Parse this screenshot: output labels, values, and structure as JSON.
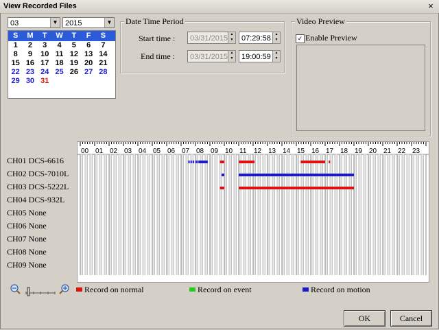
{
  "window": {
    "title": "View Recorded Files",
    "close_icon": "×"
  },
  "calendar": {
    "month": "03",
    "year": "2015",
    "weekdays": [
      "S",
      "M",
      "T",
      "W",
      "T",
      "F",
      "S"
    ],
    "weeks": [
      [
        "1",
        "2",
        "3",
        "4",
        "5",
        "6",
        "7"
      ],
      [
        "8",
        "9",
        "10",
        "11",
        "12",
        "13",
        "14"
      ],
      [
        "15",
        "16",
        "17",
        "18",
        "19",
        "20",
        "21"
      ],
      [
        "22",
        "23",
        "24",
        "25",
        "26",
        "27",
        "28"
      ],
      [
        "29",
        "30",
        "31",
        "",
        "",
        "",
        ""
      ]
    ]
  },
  "date_time_period": {
    "title": "Date Time Period",
    "start_label": "Start time :",
    "start_date": "03/31/2015",
    "start_time": "07:29:58",
    "end_label": "End time :",
    "end_date": "03/31/2015",
    "end_time": "19:00:59"
  },
  "video_preview": {
    "title": "Video Preview",
    "enable_label": "Enable Preview",
    "enabled": true,
    "check_mark": "✓"
  },
  "timeline": {
    "hours": [
      "00",
      "01",
      "02",
      "03",
      "04",
      "05",
      "06",
      "07",
      "08",
      "09",
      "10",
      "11",
      "12",
      "13",
      "14",
      "15",
      "16",
      "17",
      "18",
      "19",
      "20",
      "21",
      "22",
      "23"
    ],
    "channels": [
      {
        "label": "CH01 DCS-6616",
        "segments": [
          {
            "start": 7.5,
            "end": 7.6,
            "type": "motion"
          },
          {
            "start": 7.65,
            "end": 7.75,
            "type": "motion"
          },
          {
            "start": 7.8,
            "end": 7.9,
            "type": "motion"
          },
          {
            "start": 7.95,
            "end": 8.0,
            "type": "motion"
          },
          {
            "start": 8.05,
            "end": 8.15,
            "type": "motion"
          },
          {
            "start": 8.2,
            "end": 8.85,
            "type": "motion"
          },
          {
            "start": 9.7,
            "end": 10.0,
            "type": "normal"
          },
          {
            "start": 11.0,
            "end": 12.1,
            "type": "normal"
          },
          {
            "start": 15.3,
            "end": 17.0,
            "type": "normal"
          },
          {
            "start": 17.25,
            "end": 17.35,
            "type": "normal"
          }
        ]
      },
      {
        "label": "CH02 DCS-7010L",
        "segments": [
          {
            "start": 9.8,
            "end": 10.0,
            "type": "motion"
          },
          {
            "start": 11.0,
            "end": 19.0,
            "type": "motion"
          }
        ]
      },
      {
        "label": "CH03 DCS-5222L",
        "segments": [
          {
            "start": 9.7,
            "end": 10.0,
            "type": "normal"
          },
          {
            "start": 11.0,
            "end": 19.0,
            "type": "normal"
          }
        ]
      },
      {
        "label": "CH04 DCS-932L",
        "segments": []
      },
      {
        "label": "CH05 None",
        "segments": []
      },
      {
        "label": "CH06 None",
        "segments": []
      },
      {
        "label": "CH07 None",
        "segments": []
      },
      {
        "label": "CH08 None",
        "segments": []
      },
      {
        "label": "CH09 None",
        "segments": []
      }
    ]
  },
  "legend": {
    "normal": "Record on normal",
    "event": "Record on event",
    "motion": "Record on motion",
    "colors": {
      "normal": "#dd1111",
      "event": "#22cc22",
      "motion": "#1a1acc"
    }
  },
  "buttons": {
    "ok": "OK",
    "cancel": "Cancel"
  }
}
